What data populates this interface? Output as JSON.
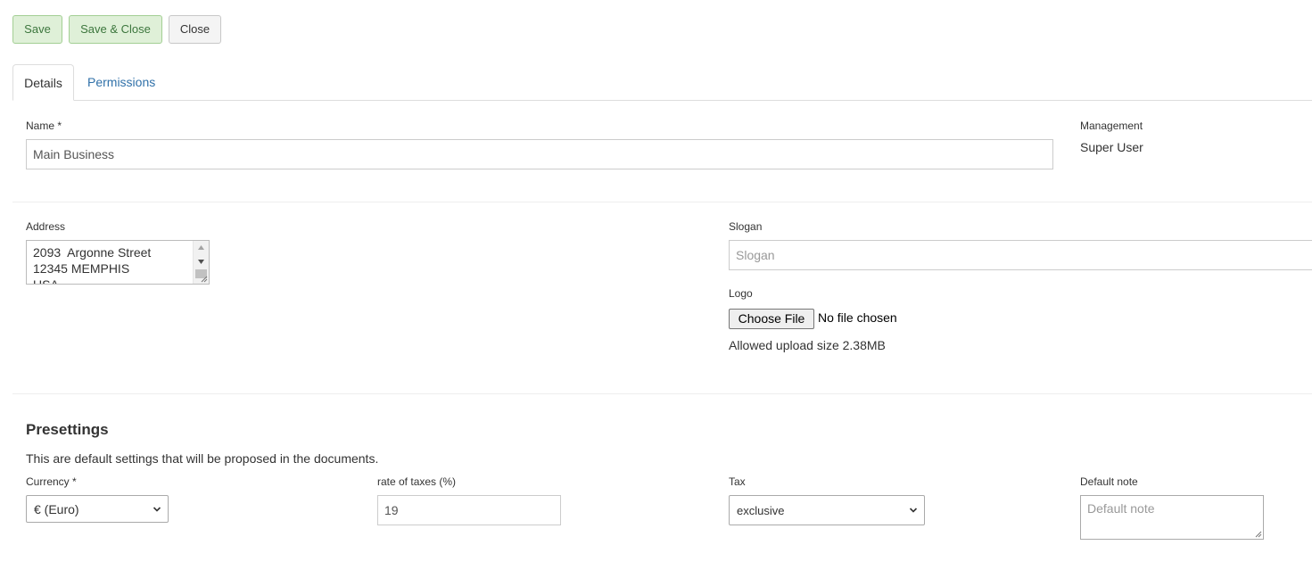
{
  "toolbar": {
    "save_label": "Save",
    "save_close_label": "Save & Close",
    "close_label": "Close"
  },
  "tabs": [
    {
      "label": "Details",
      "active": true
    },
    {
      "label": "Permissions",
      "active": false
    }
  ],
  "name": {
    "label": "Name *",
    "value": "Main Business"
  },
  "management": {
    "label": "Management",
    "value": "Super User"
  },
  "address": {
    "label": "Address",
    "lines": [
      "2093  Argonne Street",
      "12345 MEMPHIS",
      "USA"
    ]
  },
  "slogan": {
    "label": "Slogan",
    "placeholder": "Slogan",
    "value": ""
  },
  "logo": {
    "label": "Logo",
    "button_label": "Choose File",
    "status": "No file chosen",
    "upload_note": "Allowed upload size 2.38MB"
  },
  "presettings": {
    "title": "Presettings",
    "description": "This are default settings that will be proposed in the documents.",
    "currency": {
      "label": "Currency *",
      "selected": "€ (Euro)"
    },
    "tax_rate": {
      "label": "rate of taxes (%)",
      "value": "19"
    },
    "tax": {
      "label": "Tax",
      "selected": "exclusive"
    },
    "default_note": {
      "label": "Default note",
      "placeholder": "Default note"
    }
  },
  "colors": {
    "button_green_bg": "#dff0d8",
    "button_green_border": "#a3cf94",
    "link_blue": "#3071a9",
    "border_gray": "#cccccc"
  },
  "icons": [
    "chevron-down-icon",
    "scroll-up-arrow-icon",
    "scroll-down-arrow-icon",
    "resize-grip-icon"
  ]
}
